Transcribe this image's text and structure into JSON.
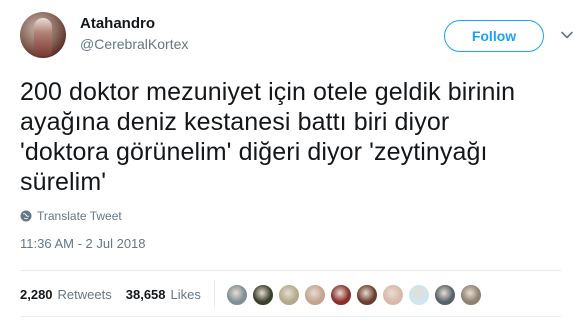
{
  "user": {
    "name": "Atahandro",
    "handle": "@CerebralKortex"
  },
  "follow_label": "Follow",
  "tweet": {
    "lines": [
      "200 doktor mezuniyet için otele geldik birinin",
      "ayağına deniz kestanesi battı biri diyor",
      "'doktora görünelim' diğeri diyor 'zeytinyağı",
      "sürelim'"
    ],
    "translate_label": "Translate Tweet",
    "timestamp": "11:36 AM - 2 Jul 2018"
  },
  "stats": {
    "retweets_count": "2,280",
    "retweets_label": "Retweets",
    "likes_count": "38,658",
    "likes_label": "Likes"
  },
  "colors": {
    "accent": "#1da1f2",
    "muted": "#657786",
    "text": "#14171a",
    "border": "#e6ecf0"
  },
  "liker_avatars": [
    {
      "color": "#7f8f96"
    },
    {
      "color": "#3a3f2c"
    },
    {
      "color": "#b3a98a"
    },
    {
      "color": "#c4a48f"
    },
    {
      "color": "#8a2f2a"
    },
    {
      "color": "#6b3d2f"
    },
    {
      "color": "#d9b9a9"
    },
    {
      "color": "#cde6f2"
    },
    {
      "color": "#55636a"
    },
    {
      "color": "#8e8172"
    }
  ]
}
